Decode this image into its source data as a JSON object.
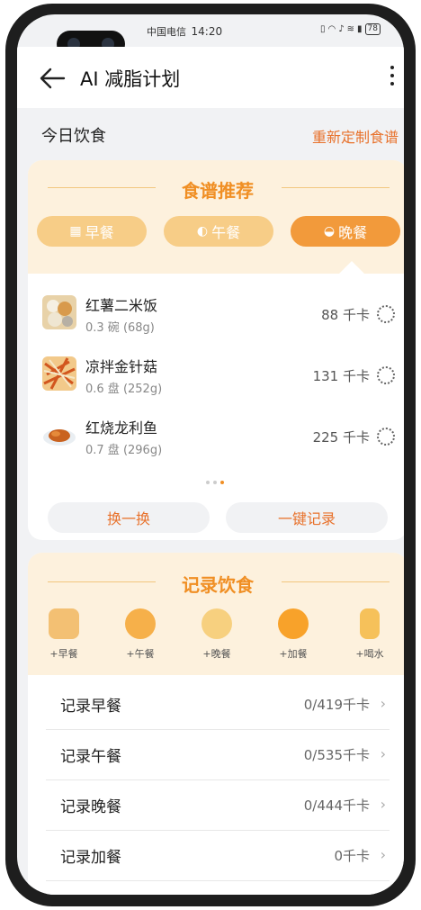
{
  "status": {
    "carrier": "中国电信",
    "time": "14:20",
    "battery": "78"
  },
  "header": {
    "title": "AI 减脂计划"
  },
  "today": {
    "label": "今日饮食",
    "customize_link": "重新定制食谱"
  },
  "recipes": {
    "title": "食谱推荐",
    "tabs": [
      {
        "label": "早餐",
        "icon": "bread-icon"
      },
      {
        "label": "午餐",
        "icon": "drumstick-icon"
      },
      {
        "label": "晚餐",
        "icon": "bowl-icon"
      }
    ],
    "selected_tab": "晚餐",
    "items": [
      {
        "name": "红薯二米饭",
        "qty": "0.3 碗 (68g)",
        "kcal": "88 千卡"
      },
      {
        "name": "凉拌金针菇",
        "qty": "0.6 盘 (252g)",
        "kcal": "131 千卡"
      },
      {
        "name": "红烧龙利鱼",
        "qty": "0.7 盘 (296g)",
        "kcal": "225 千卡"
      }
    ],
    "page_index": 3,
    "page_count": 3,
    "swap_button": "换一换",
    "record_button": "一键记录"
  },
  "record": {
    "title": "记录饮食",
    "quick_add": [
      {
        "label": "+早餐",
        "icon": "toast-icon"
      },
      {
        "label": "+午餐",
        "icon": "chicken-leg-icon"
      },
      {
        "label": "+晚餐",
        "icon": "noodle-bowl-icon"
      },
      {
        "label": "+加餐",
        "icon": "orange-icon"
      },
      {
        "label": "+喝水",
        "icon": "bottle-icon"
      }
    ],
    "rows": [
      {
        "label": "记录早餐",
        "value": "0/419千卡"
      },
      {
        "label": "记录午餐",
        "value": "0/535千卡"
      },
      {
        "label": "记录晚餐",
        "value": "0/444千卡"
      },
      {
        "label": "记录加餐",
        "value": "0千卡"
      }
    ]
  },
  "colors": {
    "accent": "#e8722c",
    "tab_active": "#f29a3b",
    "tab_inactive": "#f7cd87",
    "card_header": "#fdf1dd"
  }
}
